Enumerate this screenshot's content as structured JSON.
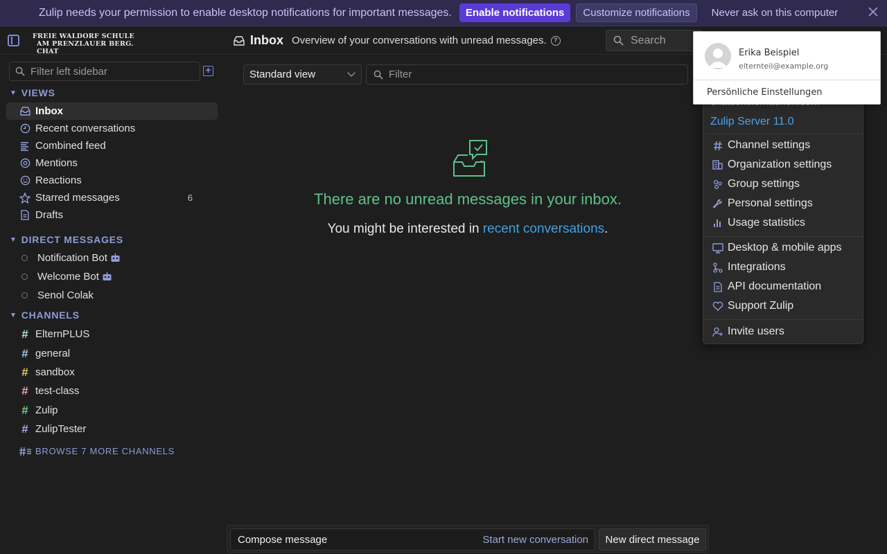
{
  "banner": {
    "message": "Zulip needs your permission to enable desktop notifications for important messages.",
    "enable_label": "Enable notifications",
    "customize_label": "Customize notifications",
    "never_label": "Never ask on this computer",
    "close_icon": "close-icon"
  },
  "header": {
    "org_line1": "FREIE WALDORF SCHULE",
    "org_line2": "AM PRENZLAUER BERG. CHAT",
    "page_title": "Inbox",
    "page_description": "Overview of your conversations with unread messages.",
    "search_label": "Search"
  },
  "sidebar": {
    "filter_placeholder": "Filter left sidebar",
    "views_heading": "VIEWS",
    "views": [
      {
        "label": "Inbox",
        "icon": "inbox-icon",
        "active": true
      },
      {
        "label": "Recent conversations",
        "icon": "clock-icon"
      },
      {
        "label": "Combined feed",
        "icon": "feed-icon"
      },
      {
        "label": "Mentions",
        "icon": "at-icon"
      },
      {
        "label": "Reactions",
        "icon": "smile-icon"
      },
      {
        "label": "Starred messages",
        "icon": "star-icon",
        "count": "6"
      },
      {
        "label": "Drafts",
        "icon": "draft-icon"
      }
    ],
    "dm_heading": "DIRECT MESSAGES",
    "direct_messages": [
      {
        "label": "Notification Bot",
        "bot": true
      },
      {
        "label": "Welcome Bot",
        "bot": true
      },
      {
        "label": "Senol Colak",
        "bot": false
      }
    ],
    "channels_heading": "CHANNELS",
    "channels": [
      {
        "label": "ElternPLUS",
        "color": "#a8e3d9"
      },
      {
        "label": "general",
        "color": "#a5c5e8"
      },
      {
        "label": "sandbox",
        "color": "#e6c95b"
      },
      {
        "label": "test-class",
        "color": "#e8a1b3"
      },
      {
        "label": "Zulip",
        "color": "#6fcf8b"
      },
      {
        "label": "ZulipTester",
        "color": "#b9a3e8"
      }
    ],
    "browse_label": "BROWSE 7 MORE CHANNELS"
  },
  "main": {
    "view_select": "Standard view",
    "filter_placeholder": "Filter",
    "empty_title": "There are no unread messages in your inbox.",
    "empty_sub_prefix": "You might be interested in ",
    "empty_sub_link": "recent conversations",
    "empty_sub_suffix": "."
  },
  "compose": {
    "compose_label": "Compose message",
    "new_conversation": "Start new conversation",
    "new_dm": "New direct message"
  },
  "gear_menu": {
    "org_url": "chatschulemachen.com",
    "server_version": "Zulip Server 11.0",
    "items_group1": [
      {
        "label": "Channel settings",
        "icon": "hash-icon"
      },
      {
        "label": "Organization settings",
        "icon": "building-icon"
      },
      {
        "label": "Group settings",
        "icon": "group-icon"
      },
      {
        "label": "Personal settings",
        "icon": "wrench-icon"
      },
      {
        "label": "Usage statistics",
        "icon": "bar-chart-icon"
      }
    ],
    "items_group2": [
      {
        "label": "Desktop & mobile apps",
        "icon": "monitor-icon"
      },
      {
        "label": "Integrations",
        "icon": "git-icon"
      },
      {
        "label": "API documentation",
        "icon": "document-icon"
      },
      {
        "label": "Support Zulip",
        "icon": "heart-icon"
      }
    ],
    "invite_label": "Invite users"
  },
  "profile_popover": {
    "name": "Erika Beispiel",
    "email": "elternteil@example.org",
    "settings_link": "Persönliche Einstellungen"
  },
  "colors": {
    "accent": "#7c8bd9",
    "success": "#5fc18b",
    "link": "#3fa3e0",
    "banner_bg": "#2f2a4e",
    "primary_button": "#5b3bd6"
  }
}
